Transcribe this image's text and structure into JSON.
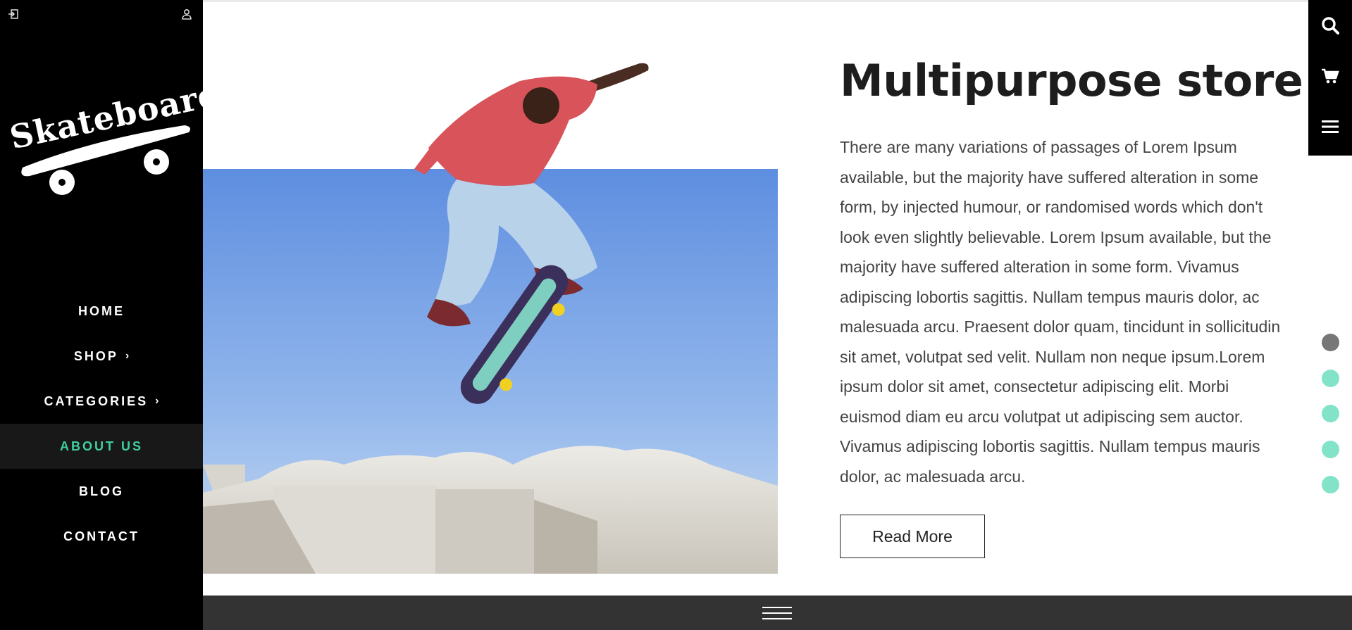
{
  "sidebar": {
    "login_icon": "login-icon",
    "user_icon": "user-icon",
    "logo_text": "Skateboard",
    "nav": [
      {
        "label": "HOME",
        "has_submenu": false,
        "active": false
      },
      {
        "label": "SHOP",
        "has_submenu": true,
        "active": false
      },
      {
        "label": "CATEGORIES",
        "has_submenu": true,
        "active": false
      },
      {
        "label": "ABOUT US",
        "has_submenu": false,
        "active": true
      },
      {
        "label": "BLOG",
        "has_submenu": false,
        "active": false
      },
      {
        "label": "CONTACT",
        "has_submenu": false,
        "active": false
      }
    ],
    "chevron": "›"
  },
  "main": {
    "title": "Multipurpose store",
    "body": "There are many variations of passages of Lorem Ipsum available, but the majority have suffered alteration in some form, by injected humour, or randomised words which don't look even slightly believable. Lorem Ipsum available, but the majority have suffered alteration in some form. Vivamus adipiscing lobortis sagittis. Nullam tempus mauris dolor, ac malesuada arcu. Praesent dolor quam, tincidunt in sollicitudin sit amet, volutpat sed velit. Nullam non neque ipsum.Lorem ipsum dolor sit amet, consectetur adipiscing elit. Morbi euismod diam eu arcu volutpat ut adipiscing sem auctor. Vivamus adipiscing lobortis sagittis. Nullam tempus mauris dolor, ac malesuada arcu.",
    "read_more_label": "Read More"
  },
  "toolbar": {
    "icons": [
      "search-icon",
      "cart-icon",
      "menu-icon"
    ]
  },
  "pager": {
    "count": 5,
    "active_index": 0
  },
  "bottom_bar": {
    "icon": "menu-icon"
  },
  "colors": {
    "accent": "#3fd0a0",
    "dot": "#83e3c9",
    "dot_active": "#777777",
    "sidebar_bg": "#000000",
    "bottom_bar_bg": "#333333"
  }
}
